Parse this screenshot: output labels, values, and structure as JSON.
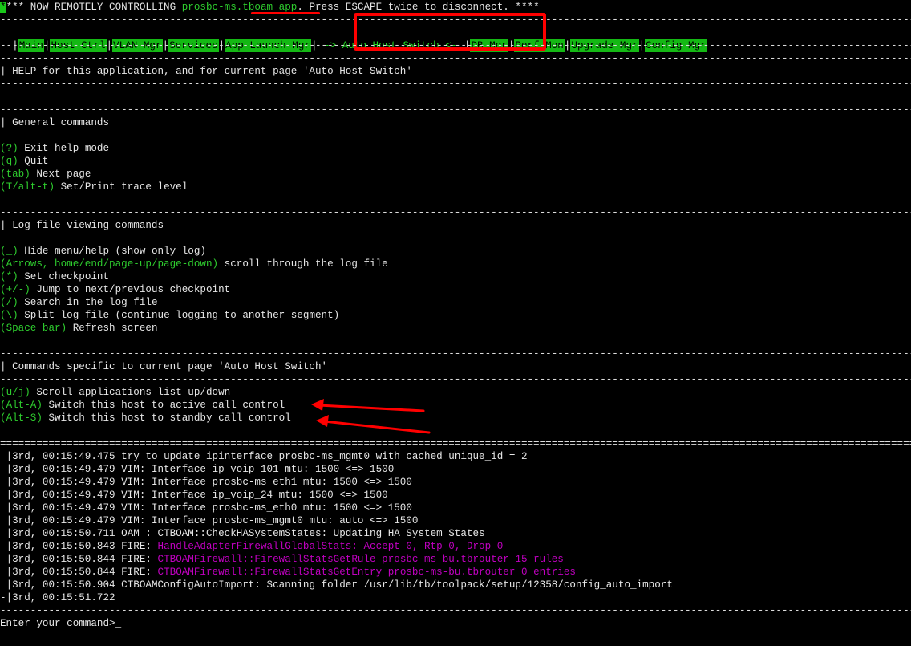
{
  "header": {
    "lead": "*",
    "prefix": "*** NOW REMOTELY CONTROLLING ",
    "host": "prosbc-ms.tboam app",
    "suffix": ". Press ESCAPE twice to disconnect. ****"
  },
  "separator": "------------------------------------------------------------------------------------------------------------------------------------------------------------------------------------------------------------------------",
  "double_separator": "======================================================================================================================================================================================================================",
  "tabs": [
    {
      "label": "Main"
    },
    {
      "label": "Host Ctrl"
    },
    {
      "label": "VLAN Mgr"
    },
    {
      "label": "Services"
    },
    {
      "label": "App Launch Mgr"
    },
    {
      "label": "-> Auto Host Switch <-"
    },
    {
      "label": "DB Mgr"
    },
    {
      "label": "Perf Mon"
    },
    {
      "label": "Upgrade Mgr"
    },
    {
      "label": "Config Mgr"
    }
  ],
  "help_title": "| HELP for this application, and for current page 'Auto Host Switch'",
  "general": {
    "title": "| General commands",
    "items": [
      {
        "key": "?",
        "desc": " Exit help mode"
      },
      {
        "key": "q",
        "desc": " Quit"
      },
      {
        "key": "tab",
        "desc": " Next page"
      },
      {
        "key": "T/alt-t",
        "desc": " Set/Print trace level"
      }
    ]
  },
  "log_cmds": {
    "title": "| Log file viewing commands",
    "items": [
      {
        "key": "_",
        "desc": " Hide menu/help (show only log)"
      },
      {
        "key": "Arrows, home/end/page-up/page-down",
        "desc": " scroll through the log file"
      },
      {
        "key": "*",
        "desc": " Set checkpoint"
      },
      {
        "key": "+/-",
        "desc": " Jump to next/previous checkpoint"
      },
      {
        "key": "/",
        "desc": " Search in the log file"
      },
      {
        "key": "\\",
        "desc": " Split log file (continue logging to another segment)"
      },
      {
        "key": "Space bar",
        "desc": " Refresh screen"
      }
    ]
  },
  "page_cmds": {
    "title": "| Commands specific to current page 'Auto Host Switch'",
    "items": [
      {
        "key": "u/j",
        "desc": " Scroll applications list up/down"
      },
      {
        "key": "Alt-A",
        "desc": " Switch this host to active call control"
      },
      {
        "key": "Alt-S",
        "desc": " Switch this host to standby call control"
      }
    ]
  },
  "log": [
    {
      "lead": " ",
      "ts": "|3rd, 00:15:49.475",
      "text": " try to update ipinterface prosbc-ms_mgmt0 with cached unique_id = 2",
      "tag": "",
      "magenta": ""
    },
    {
      "lead": " ",
      "ts": "|3rd, 00:15:49.479",
      "text": " VIM: Interface ip_voip_101 mtu: 1500 <=> 1500",
      "tag": "",
      "magenta": ""
    },
    {
      "lead": " ",
      "ts": "|3rd, 00:15:49.479",
      "text": " VIM: Interface prosbc-ms_eth1 mtu: 1500 <=> 1500",
      "tag": "",
      "magenta": ""
    },
    {
      "lead": " ",
      "ts": "|3rd, 00:15:49.479",
      "text": " VIM: Interface ip_voip_24 mtu: 1500 <=> 1500",
      "tag": "",
      "magenta": ""
    },
    {
      "lead": " ",
      "ts": "|3rd, 00:15:49.479",
      "text": " VIM: Interface prosbc-ms_eth0 mtu: 1500 <=> 1500",
      "tag": "",
      "magenta": ""
    },
    {
      "lead": " ",
      "ts": "|3rd, 00:15:49.479",
      "text": " VIM: Interface prosbc-ms_mgmt0 mtu: auto <=> 1500",
      "tag": "",
      "magenta": ""
    },
    {
      "lead": " ",
      "ts": "|3rd, 00:15:50.711",
      "text": " OAM : CTBOAM::CheckHASystemStates: Updating HA System States",
      "tag": "",
      "magenta": ""
    },
    {
      "lead": " ",
      "ts": "|3rd, 00:15:50.843",
      "text": "",
      "tag": " FIRE: ",
      "magenta": "HandleAdapterFirewallGlobalStats: Accept 0, Rtp 0, Drop 0"
    },
    {
      "lead": " ",
      "ts": "|3rd, 00:15:50.844",
      "text": "",
      "tag": " FIRE: ",
      "magenta": "CTBOAMFirewall::FirewallStatsGetRule prosbc-ms-bu.tbrouter 15 rules"
    },
    {
      "lead": " ",
      "ts": "|3rd, 00:15:50.844",
      "text": "",
      "tag": " FIRE: ",
      "magenta": "CTBOAMFirewall::FirewallStatsGetEntry prosbc-ms-bu.tbrouter 0 entries"
    },
    {
      "lead": " ",
      "ts": "|3rd, 00:15:50.904",
      "text": " CTBOAMConfigAutoImport: Scanning folder /usr/lib/tb/toolpack/setup/12358/config_auto_import",
      "tag": "",
      "magenta": ""
    },
    {
      "lead": "-",
      "ts": "|3rd, 00:15:51.722",
      "text": "",
      "tag": "",
      "magenta": ""
    }
  ],
  "prompt": "Enter your command>_",
  "colors": {
    "background": "#000000",
    "text": "#e6e6e6",
    "key_green": "#2ecc2e",
    "tab_bg": "#14b814",
    "magenta": "#c000c0",
    "annotation_red": "#ff0000"
  }
}
